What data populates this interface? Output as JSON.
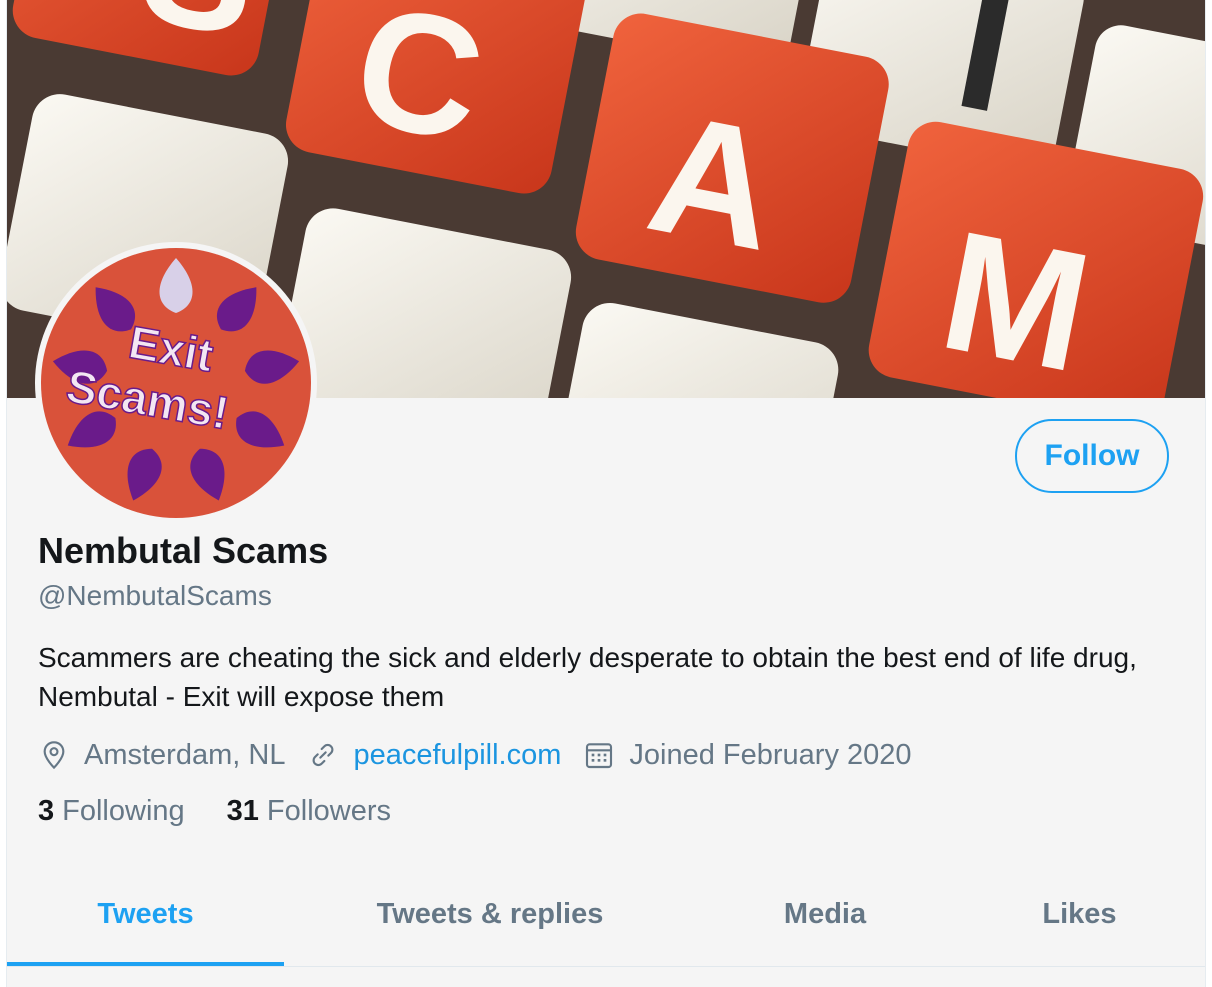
{
  "profile": {
    "name": "Nembutal Scams",
    "handle": "@NembutalScams",
    "bio": "Scammers are cheating the sick and elderly desperate to obtain the best end of life drug, Nembutal - Exit will expose them",
    "location": "Amsterdam, NL",
    "website": "peacefulpill.com",
    "joined": "Joined February 2020",
    "following_count": "3",
    "following_label": "Following",
    "followers_count": "31",
    "followers_label": "Followers"
  },
  "banner": {
    "keys": [
      "S",
      "C",
      "A",
      "M"
    ]
  },
  "avatar": {
    "line1": "Exit",
    "line2": "Scams!"
  },
  "actions": {
    "follow_label": "Follow"
  },
  "tabs": [
    {
      "label": "Tweets",
      "active": true
    },
    {
      "label": "Tweets & replies",
      "active": false
    },
    {
      "label": "Media",
      "active": false
    },
    {
      "label": "Likes",
      "active": false
    }
  ],
  "icons": {
    "location": "location-pin-icon",
    "website": "link-icon",
    "joined": "calendar-icon"
  },
  "colors": {
    "accent": "#1da1f2",
    "link": "#1b95e0",
    "key_red": "#e24a2a",
    "key_cream": "#efece4",
    "avatar_bg": "#d9523a",
    "petal": "#6a1b8a"
  }
}
